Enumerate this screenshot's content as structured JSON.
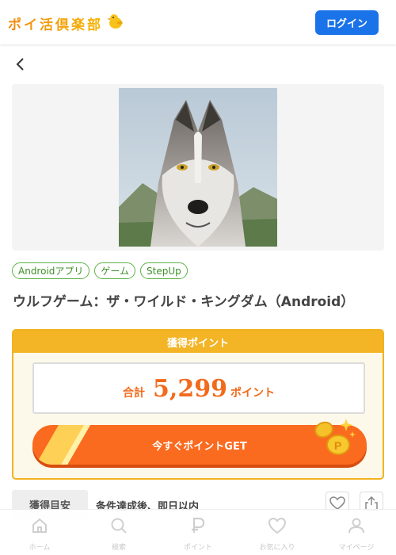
{
  "header": {
    "logo_text": "ポイ活倶楽部",
    "login_label": "ログイン"
  },
  "colors": {
    "brand_orange": "#f26a1b",
    "accent_yellow": "#f3b425",
    "login_blue": "#1a73e8",
    "tag_green": "#5db345"
  },
  "offer": {
    "tags": [
      "Androidアプリ",
      "ゲーム",
      "StepUp"
    ],
    "title": "ウルフゲーム：ザ・ワイルド・キングダム（Android）"
  },
  "points": {
    "header": "獲得ポイント",
    "total_label": "合計",
    "total_value": "5,299",
    "unit": "ポイント",
    "get_button": "今すぐポイントGET"
  },
  "guide": {
    "label": "獲得目安",
    "value": "条件達成後、即日以内"
  },
  "nav": {
    "items": [
      {
        "label": "ホーム",
        "icon": "home-icon"
      },
      {
        "label": "検索",
        "icon": "search-icon"
      },
      {
        "label": "ポイント",
        "icon": "point-icon"
      },
      {
        "label": "お気に入り",
        "icon": "heart-icon"
      },
      {
        "label": "マイページ",
        "icon": "user-icon"
      }
    ]
  }
}
